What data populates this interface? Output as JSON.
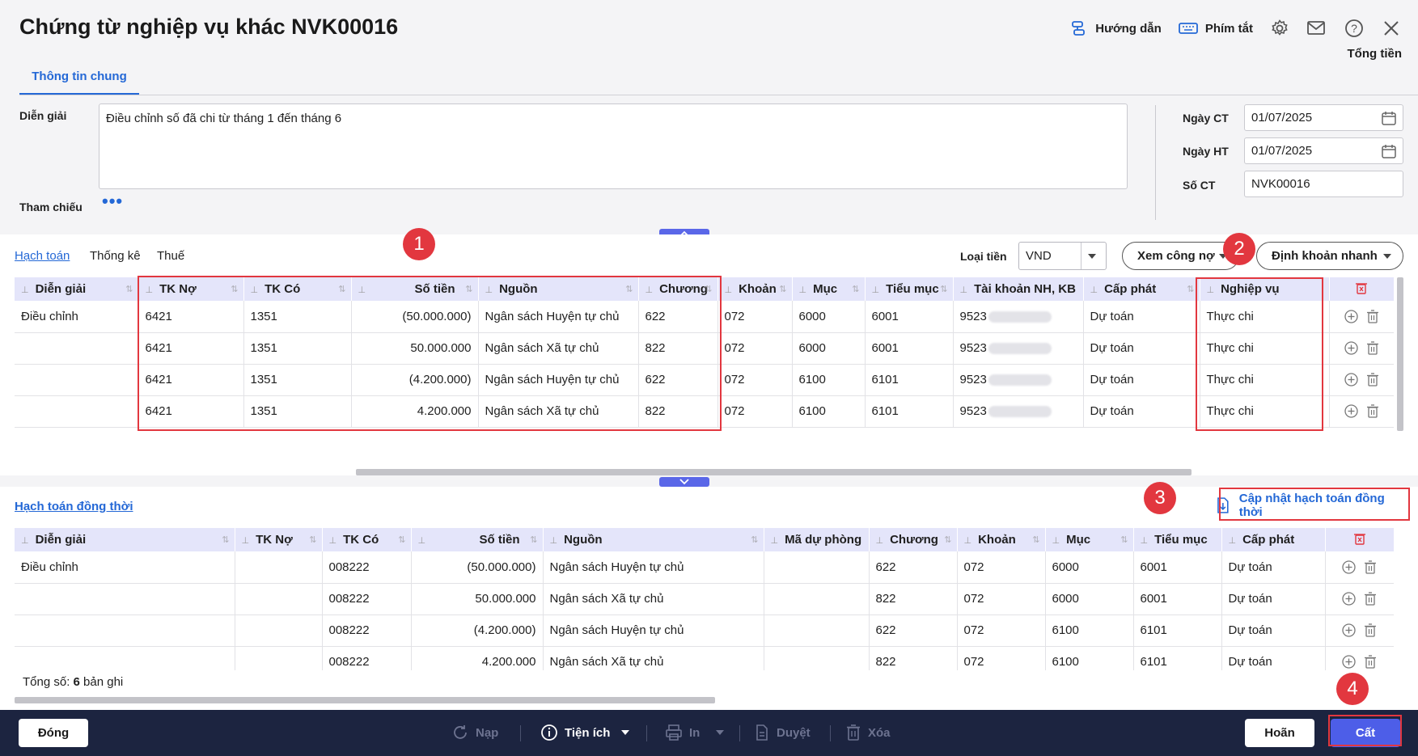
{
  "header": {
    "title": "Chứng từ nghiệp vụ khác NVK00016",
    "help_label": "Hướng dẫn",
    "shortcut_label": "Phím tắt",
    "total_label": "Tổng tiền",
    "tab_general": "Thông tin chung",
    "icons": [
      "guide-icon",
      "keyboard-icon",
      "gear-icon",
      "mail-icon",
      "help-icon",
      "close-icon"
    ]
  },
  "form": {
    "description_label": "Diễn giải",
    "description_value": "Điều chỉnh số đã chi từ tháng 1 đến tháng 6",
    "reference_label": "Tham chiếu",
    "reference_more": "•••",
    "date_ct_label": "Ngày CT",
    "date_ct_value": "01/07/2025",
    "date_ht_label": "Ngày HT",
    "date_ht_value": "01/07/2025",
    "so_ct_label": "Số CT",
    "so_ct_value": "NVK00016"
  },
  "accounting": {
    "tabs": [
      "Hạch toán",
      "Thống kê",
      "Thuế"
    ],
    "currency_label": "Loại tiền",
    "currency_value": "VND",
    "debt_button": "Xem công nợ",
    "quick_button": "Định khoản nhanh",
    "columns": [
      "Diễn giải",
      "TK Nợ",
      "TK Có",
      "Số tiền",
      "Nguồn",
      "Chương",
      "Khoản",
      "Mục",
      "Tiểu mục",
      "Tài khoản NH, KB",
      "Cấp phát",
      "Nghiệp vụ"
    ],
    "rows": [
      {
        "desc": "Điều chỉnh",
        "no": "6421",
        "co": "1351",
        "amount": "(50.000.000)",
        "source": "Ngân sách Huyện tự chủ",
        "chuong": "622",
        "khoan": "072",
        "muc": "6000",
        "tieumuc": "6001",
        "bank": "9523",
        "capphat": "Dự toán",
        "nghiepvu": "Thực chi"
      },
      {
        "desc": "",
        "no": "6421",
        "co": "1351",
        "amount": "50.000.000",
        "source": "Ngân sách Xã tự chủ",
        "chuong": "822",
        "khoan": "072",
        "muc": "6000",
        "tieumuc": "6001",
        "bank": "9523",
        "capphat": "Dự toán",
        "nghiepvu": "Thực chi"
      },
      {
        "desc": "",
        "no": "6421",
        "co": "1351",
        "amount": "(4.200.000)",
        "source": "Ngân sách Huyện tự chủ",
        "chuong": "622",
        "khoan": "072",
        "muc": "6100",
        "tieumuc": "6101",
        "bank": "9523",
        "capphat": "Dự toán",
        "nghiepvu": "Thực chi"
      },
      {
        "desc": "",
        "no": "6421",
        "co": "1351",
        "amount": "4.200.000",
        "source": "Ngân sách Xã tự chủ",
        "chuong": "822",
        "khoan": "072",
        "muc": "6100",
        "tieumuc": "6101",
        "bank": "9523",
        "capphat": "Dự toán",
        "nghiepvu": "Thực chi"
      }
    ]
  },
  "concurrent": {
    "tab": "Hạch toán đồng thời",
    "update_button": "Cập nhật hạch toán đồng thời",
    "columns": [
      "Diễn giải",
      "TK Nợ",
      "TK Có",
      "Số tiền",
      "Nguồn",
      "Mã dự phòng",
      "Chương",
      "Khoản",
      "Mục",
      "Tiểu mục",
      "Cấp phát"
    ],
    "rows": [
      {
        "desc": "Điều chỉnh",
        "no": "",
        "co": "008222",
        "amount": "(50.000.000)",
        "source": "Ngân sách Huyện tự chủ",
        "maduphong": "",
        "chuong": "622",
        "khoan": "072",
        "muc": "6000",
        "tieumuc": "6001",
        "capphat": "Dự toán"
      },
      {
        "desc": "",
        "no": "",
        "co": "008222",
        "amount": "50.000.000",
        "source": "Ngân sách Xã tự chủ",
        "maduphong": "",
        "chuong": "822",
        "khoan": "072",
        "muc": "6000",
        "tieumuc": "6001",
        "capphat": "Dự toán"
      },
      {
        "desc": "",
        "no": "",
        "co": "008222",
        "amount": "(4.200.000)",
        "source": "Ngân sách Huyện tự chủ",
        "maduphong": "",
        "chuong": "622",
        "khoan": "072",
        "muc": "6100",
        "tieumuc": "6101",
        "capphat": "Dự toán"
      },
      {
        "desc": "",
        "no": "",
        "co": "008222",
        "amount": "4.200.000",
        "source": "Ngân sách Xã tự chủ",
        "maduphong": "",
        "chuong": "822",
        "khoan": "072",
        "muc": "6100",
        "tieumuc": "6101",
        "capphat": "Dự toán"
      }
    ],
    "total_prefix": "Tổng số: ",
    "total_count": "6",
    "total_suffix": " bản ghi"
  },
  "annotations": [
    "1",
    "2",
    "3",
    "4"
  ],
  "footer": {
    "close_button": "Đóng",
    "reload": "Nạp",
    "utility": "Tiện ích",
    "print": "In",
    "approve": "Duyệt",
    "delete": "Xóa",
    "cancel_button": "Hoãn",
    "save_button": "Cất"
  },
  "colors": {
    "accent": "#2468d6",
    "annotation": "#e2373f",
    "footer_bg": "#1c2440",
    "save_bg": "#4d5ee8",
    "header_row": "#e4e5fa"
  }
}
